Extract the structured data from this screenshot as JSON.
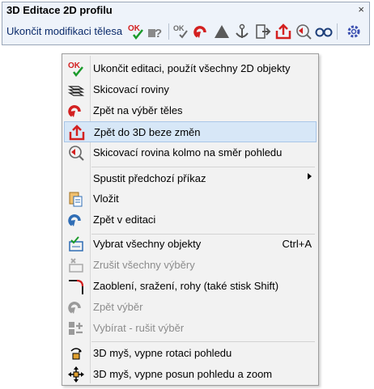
{
  "toolbar": {
    "title": "3D Editace 2D profilu",
    "close_glyph": "×",
    "command_label": "Ukončit modifikaci tělesa",
    "icons": [
      "ok-check-icon",
      "help-question-icon",
      "ok-small-icon",
      "undo-red-icon",
      "triangle-icon",
      "anchor-icon",
      "export-icon",
      "return-3d-icon",
      "view-plane-icon",
      "glasses-icon",
      "settings-icon"
    ]
  },
  "menu": {
    "items": [
      {
        "label": "Ukončit editaci, použít všechny 2D objekty",
        "icon": "ok-check-icon",
        "disabled": false
      },
      {
        "label": "Skicovací roviny",
        "icon": "sketch-planes-icon",
        "disabled": false
      },
      {
        "label": "Zpět na výběr těles",
        "icon": "undo-red-icon",
        "disabled": false
      },
      {
        "label": "Zpět do 3D beze změn",
        "icon": "return-3d-icon",
        "disabled": false,
        "highlighted": true
      },
      {
        "label": "Skicovací rovina kolmo na směr pohledu",
        "icon": "view-plane-icon",
        "disabled": false
      },
      {
        "label": "Spustit předchozí příkaz",
        "icon": "",
        "disabled": false,
        "submenu": true
      },
      {
        "label": "Vložit",
        "icon": "paste-icon",
        "disabled": false
      },
      {
        "label": "Zpět v editaci",
        "icon": "undo-blue-icon",
        "disabled": false
      },
      {
        "label": "Vybrat všechny objekty",
        "icon": "select-all-icon",
        "disabled": false,
        "shortcut": "Ctrl+A"
      },
      {
        "label": "Zrušit všechny výběry",
        "icon": "deselect-icon",
        "disabled": true
      },
      {
        "label": "Zaoblení, sražení, rohy (také stisk Shift)",
        "icon": "fillet-icon",
        "disabled": false
      },
      {
        "label": "Zpět výběr",
        "icon": "undo-select-icon",
        "disabled": true
      },
      {
        "label": "Vybírat - rušit výběr",
        "icon": "toggle-select-icon",
        "disabled": true
      },
      {
        "label": "3D myš, vypne rotaci pohledu",
        "icon": "3d-mouse-rotate-icon",
        "disabled": false
      },
      {
        "label": "3D myš, vypne posun pohledu a zoom",
        "icon": "3d-mouse-pan-icon",
        "disabled": false
      }
    ]
  },
  "colors": {
    "accent": "#d32020",
    "ok_green": "#1a9a2a",
    "blue": "#2f6db5",
    "highlight": "#d7e7f7"
  }
}
